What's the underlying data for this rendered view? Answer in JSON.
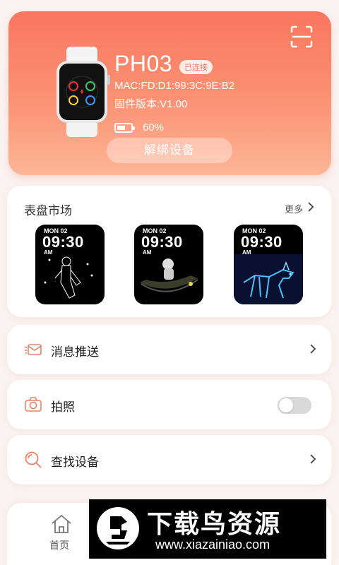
{
  "device": {
    "name": "PH03",
    "status_badge": "已连接",
    "mac": "MAC:FD:D1:99:3C:9E:B2",
    "firmware": "固件版本:V1.00",
    "battery_percent_text": "60%",
    "battery_level": 0.6,
    "unbind_label": "解绑设备"
  },
  "market": {
    "title": "表盘市场",
    "more_label": "更多",
    "faces": [
      {
        "date": "MON 02",
        "time": "09:30",
        "ampm": "AM",
        "art": "astronaut-line-art"
      },
      {
        "date": "MON 02",
        "time": "09:30",
        "ampm": "AM",
        "art": "astronaut-boat"
      },
      {
        "date": "MON 02",
        "time": "09:30",
        "ampm": "AM",
        "art": "glowing-wolf"
      }
    ]
  },
  "menu": {
    "push_label": "消息推送",
    "photo_label": "拍照",
    "photo_toggle_on": false,
    "find_label": "查找设备"
  },
  "tabbar": {
    "home_label": "首页"
  },
  "watermark": {
    "title": "下载鸟资源",
    "url": "www.xiazainiao.com"
  },
  "colors": {
    "accent": "#f9765e",
    "icon": "#e9806a"
  }
}
